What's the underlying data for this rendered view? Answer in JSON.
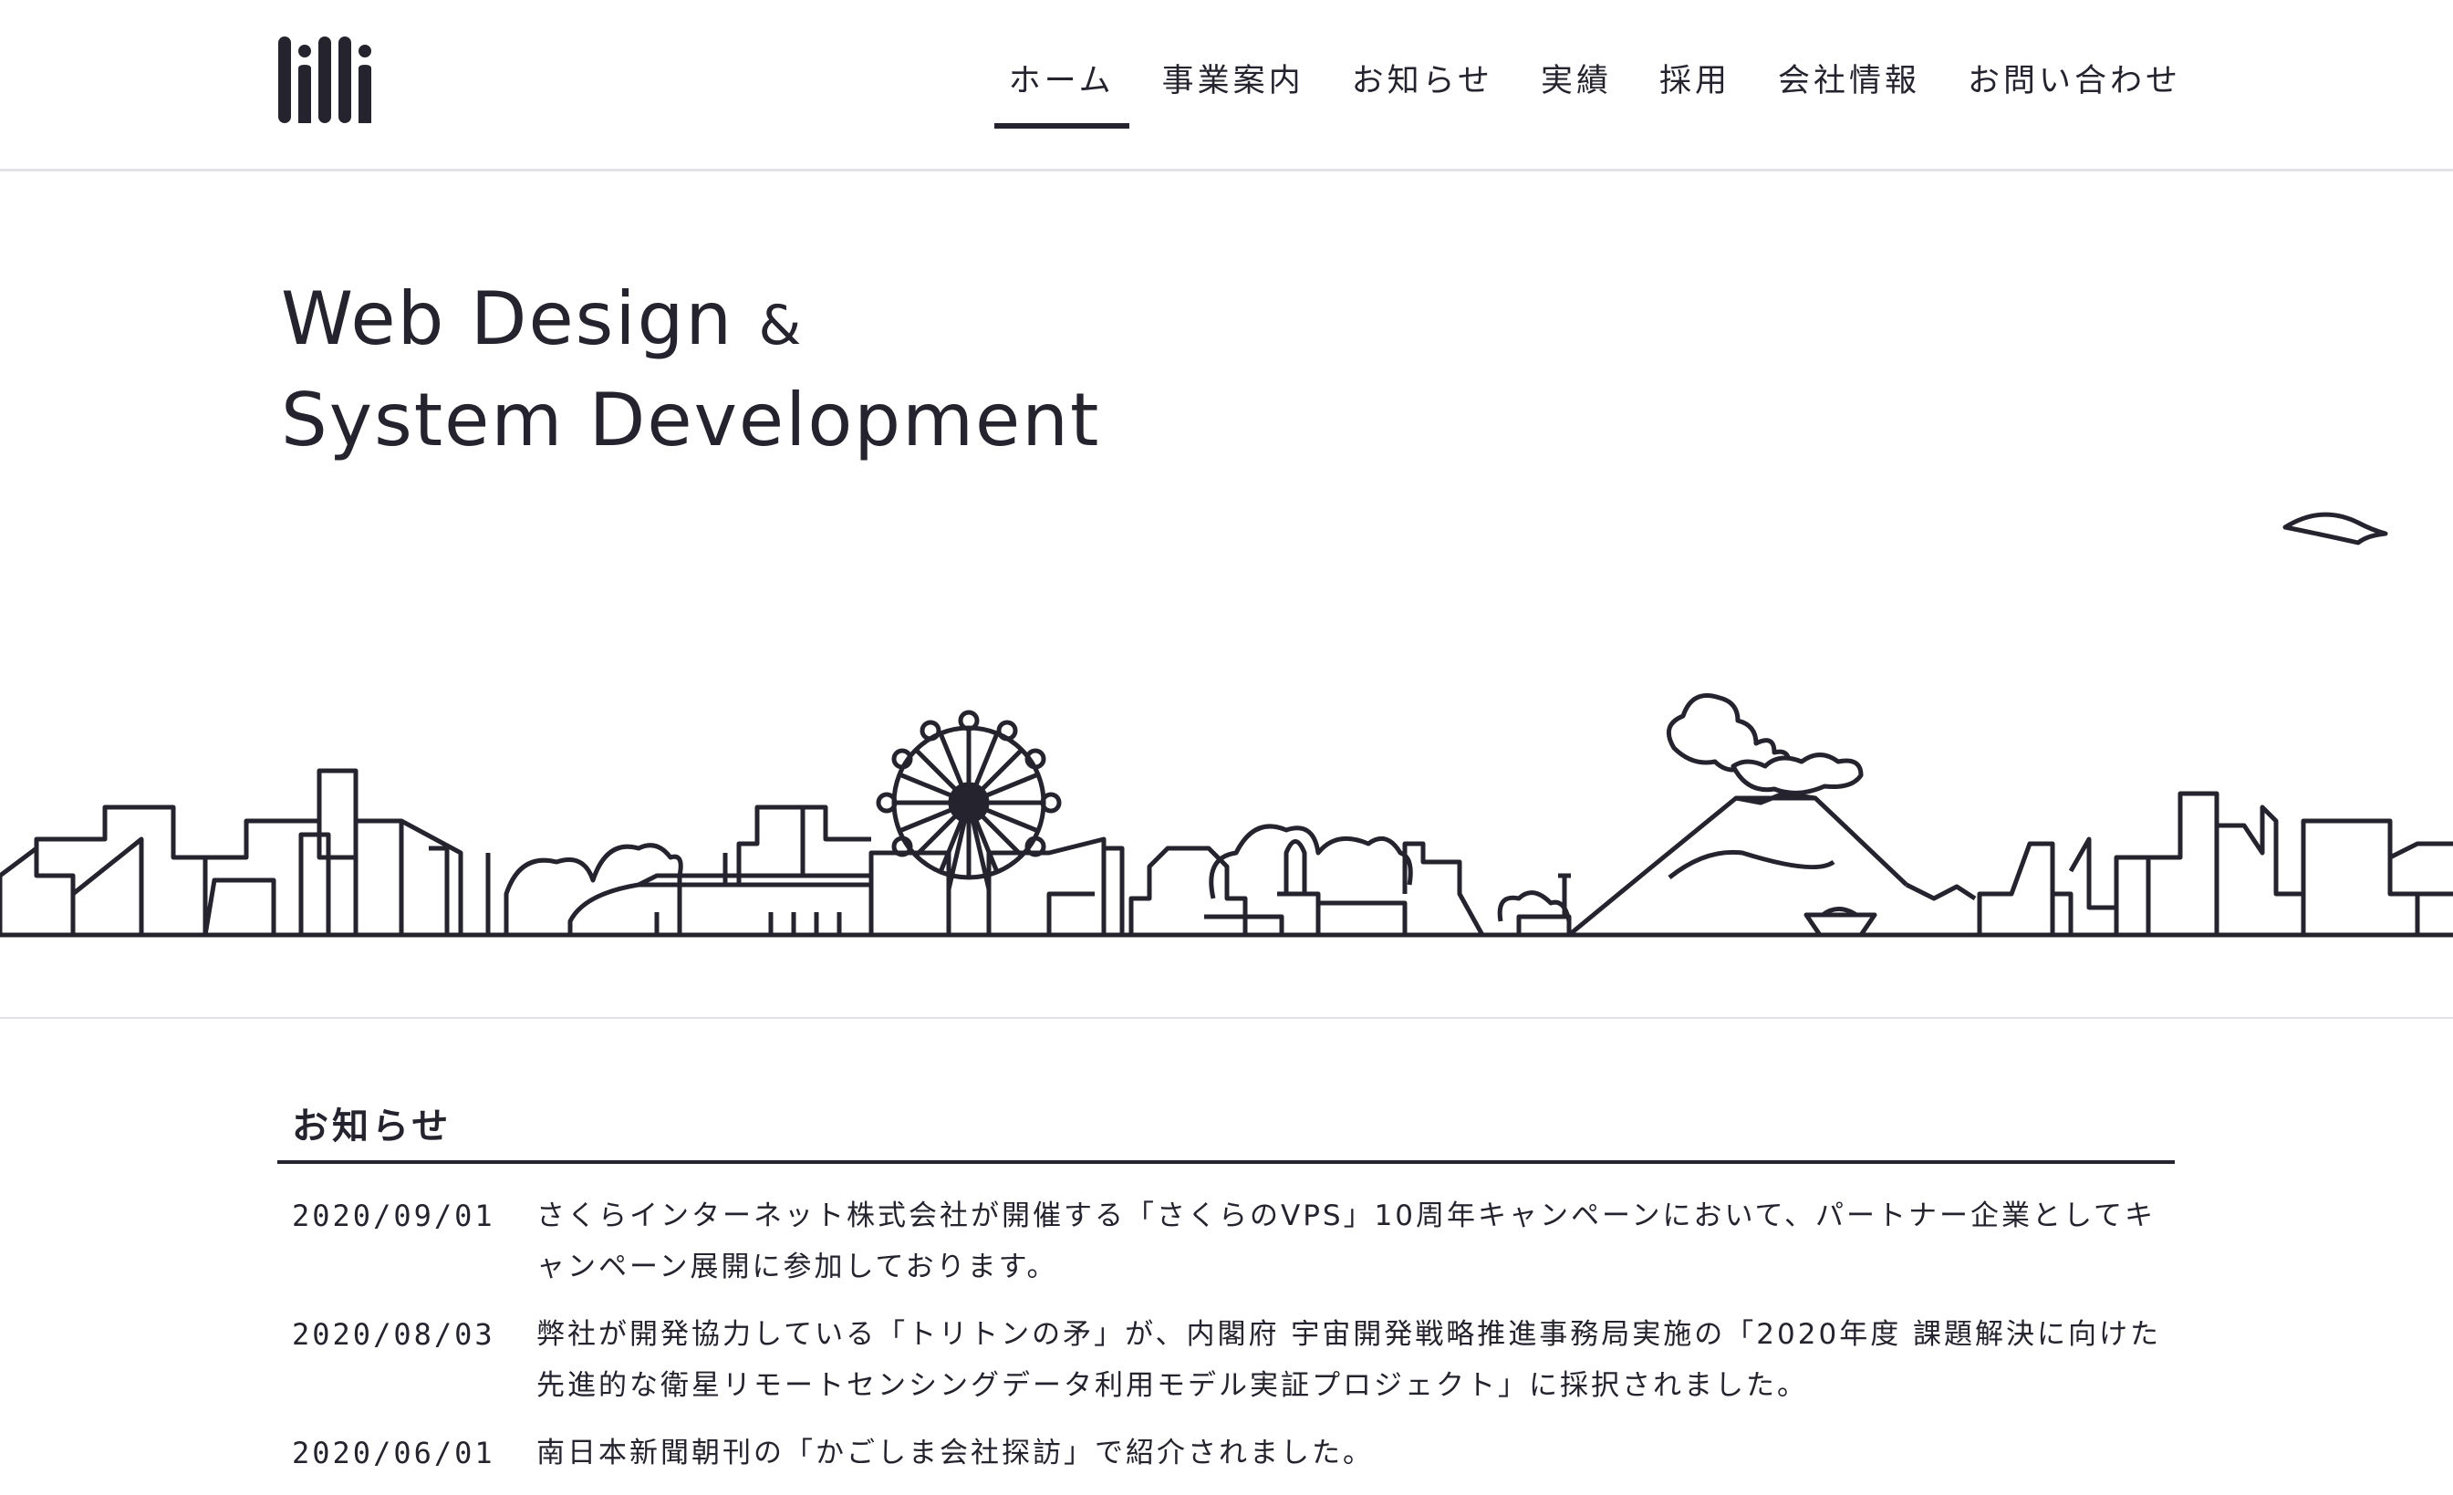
{
  "brand": {
    "logo_alt": "lilli"
  },
  "nav": {
    "items": [
      {
        "label": "ホーム",
        "active": true
      },
      {
        "label": "事業案内",
        "active": false
      },
      {
        "label": "お知らせ",
        "active": false
      },
      {
        "label": "実績",
        "active": false
      },
      {
        "label": "採用",
        "active": false
      },
      {
        "label": "会社情報",
        "active": false
      },
      {
        "label": "お問い合わせ",
        "active": false
      }
    ]
  },
  "hero": {
    "line1": "Web Design",
    "amp": "&",
    "line2": "System Development"
  },
  "news": {
    "title": "お知らせ",
    "items": [
      {
        "date": "2020/09/01",
        "text": "さくらインターネット株式会社が開催する「さくらのVPS」10周年キャンペーンにおいて、パートナー企業としてキャンペーン展開に参加しております。"
      },
      {
        "date": "2020/08/03",
        "text": "弊社が開発協力している「トリトンの矛」が、内閣府 宇宙開発戦略推進事務局実施の「2020年度 課題解決に向けた先進的な衛星リモートセンシングデータ利用モデル実証プロジェクト」に採択されました。"
      },
      {
        "date": "2020/06/01",
        "text": "南日本新聞朝刊の「かごしま会社探訪」で紹介されました。"
      }
    ]
  },
  "colors": {
    "ink": "#24232e",
    "rule": "#e2e2e6",
    "background": "#ffffff"
  }
}
